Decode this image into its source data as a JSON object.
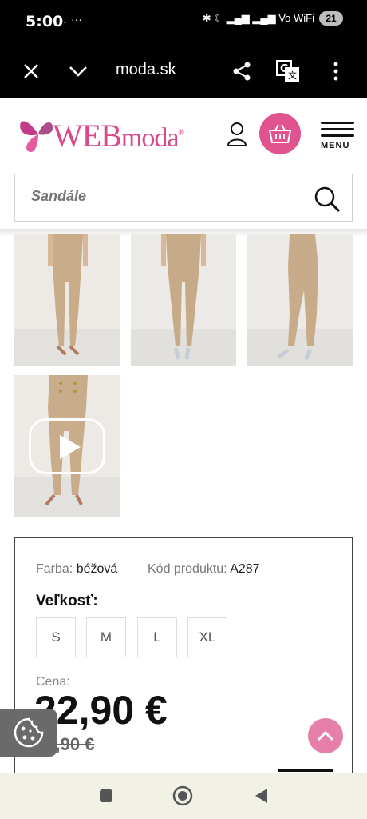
{
  "status_bar": {
    "time": "5:00",
    "left_icons": "↓ ···",
    "right_icons": "✱ ☾ ▂▄▆ ▂▄▆ Vo WiFi",
    "battery": "21"
  },
  "browser": {
    "url": "moda.sk",
    "icons": [
      "close-icon",
      "chevron-down-icon",
      "share-icon",
      "translate-icon",
      "more-vert-icon"
    ]
  },
  "header": {
    "logo_text_big": "WEB",
    "logo_text_small": "moda",
    "menu_label": "MENU",
    "accent_color": "#e0538f"
  },
  "search": {
    "placeholder": "Sandále"
  },
  "product": {
    "color_label": "Farba:",
    "color_value": "béžová",
    "code_label": "Kód produktu:",
    "code_value": "A287",
    "size_title": "Veľkosť:",
    "sizes": [
      "S",
      "M",
      "L",
      "XL"
    ],
    "price_label": "Cena:",
    "price": "22,90 €",
    "old_price": "26,90 €"
  }
}
